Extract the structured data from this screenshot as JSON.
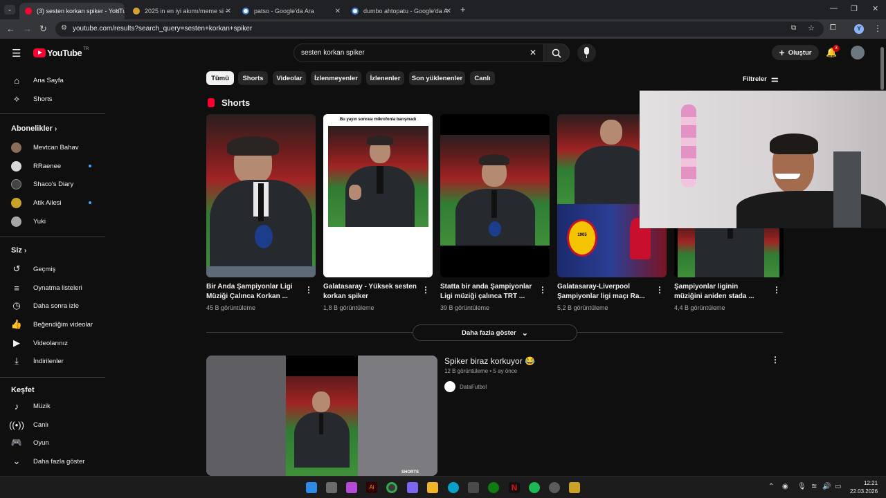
{
  "browser": {
    "tabs": [
      {
        "title": "(3) sesten korkan spiker - YouTu",
        "color": "#ff0033"
      },
      {
        "title": "2025 in en iyi akımı/meme si - ",
        "color": "#d6a035"
      },
      {
        "title": "patso - Google'da Ara",
        "color": "#ffffff"
      },
      {
        "title": "dumbo ahtopatu - Google'da A",
        "color": "#ffffff"
      }
    ],
    "url": "youtube.com/results?search_query=sesten+korkan+spiker",
    "profile_letter": "Y"
  },
  "youtube": {
    "logo_text": "YouTube",
    "logo_region": "TR",
    "search_value": "sesten korkan spiker",
    "create_label": "Oluştur",
    "notification_count": "3",
    "sidebar": {
      "main": [
        {
          "label": "Ana Sayfa",
          "icon": "home-icon"
        },
        {
          "label": "Shorts",
          "icon": "shorts-icon"
        }
      ],
      "subscriptions_title": "Abonelikler",
      "subscriptions": [
        {
          "label": "Mevtcan Bahav",
          "color": "#8a6e5a",
          "new": false
        },
        {
          "label": "RRaenee",
          "color": "#d9d9d9",
          "new": true
        },
        {
          "label": "Shaco's Diary",
          "color": "#444444",
          "new": false
        },
        {
          "label": "Atik Ailesi",
          "color": "#c9a227",
          "new": true
        },
        {
          "label": "Yuki",
          "color": "#a7a7a7",
          "new": false
        }
      ],
      "you_title": "Siz",
      "you": [
        {
          "label": "Geçmiş",
          "icon": "history-icon"
        },
        {
          "label": "Oynatma listeleri",
          "icon": "playlist-icon"
        },
        {
          "label": "Daha sonra izle",
          "icon": "clock-icon"
        },
        {
          "label": "Beğendiğim videolar",
          "icon": "like-icon"
        },
        {
          "label": "Videolarınız",
          "icon": "video-icon"
        },
        {
          "label": "İndirilenler",
          "icon": "download-icon"
        }
      ],
      "explore_title": "Keşfet",
      "explore": [
        {
          "label": "Müzik",
          "icon": "music-icon"
        },
        {
          "label": "Canlı",
          "icon": "live-icon"
        },
        {
          "label": "Oyun",
          "icon": "gaming-icon"
        },
        {
          "label": "Daha fazla göster",
          "icon": "chevron-down-icon"
        }
      ]
    },
    "chips": [
      "Tümü",
      "Shorts",
      "Videolar",
      "İzlenmeyenler",
      "İzlenenler",
      "Son yüklenenler",
      "Canlı"
    ],
    "filters_label": "Filtreler",
    "shorts_title": "Shorts",
    "shorts": [
      {
        "title": "Bir Anda Şampiyonlar Ligi Müziği Çalınca Korkan ...",
        "views": "45 B görüntüleme"
      },
      {
        "title": "Galatasaray - Yüksek sesten korkan spiker",
        "views": "1,8 B görüntüleme",
        "caption": "Bu yayın sonrası mikrofonla barışmadı"
      },
      {
        "title": "Statta bir anda Şampiyonlar Ligi müziği çalınca TRT ...",
        "views": "39 B görüntüleme"
      },
      {
        "title": "Galatasaray-Liverpool Şampiyonlar ligi maçı Ra...",
        "views": "5,2 B görüntüleme",
        "badge_year": "1905"
      },
      {
        "title": "Şampiyonlar liginin müziğini aniden stada ...",
        "views": "4,4 B görüntüleme"
      }
    ],
    "show_more_label": "Daha fazla göster",
    "video": {
      "title": "Spiker biraz korkuyor 😂",
      "views": "12 B görüntüleme",
      "age": "5 ay önce",
      "channel": "DataFutbol",
      "badge": "SHORTS"
    }
  },
  "taskbar": {
    "time": "12:21",
    "date": "22.03.2026"
  }
}
